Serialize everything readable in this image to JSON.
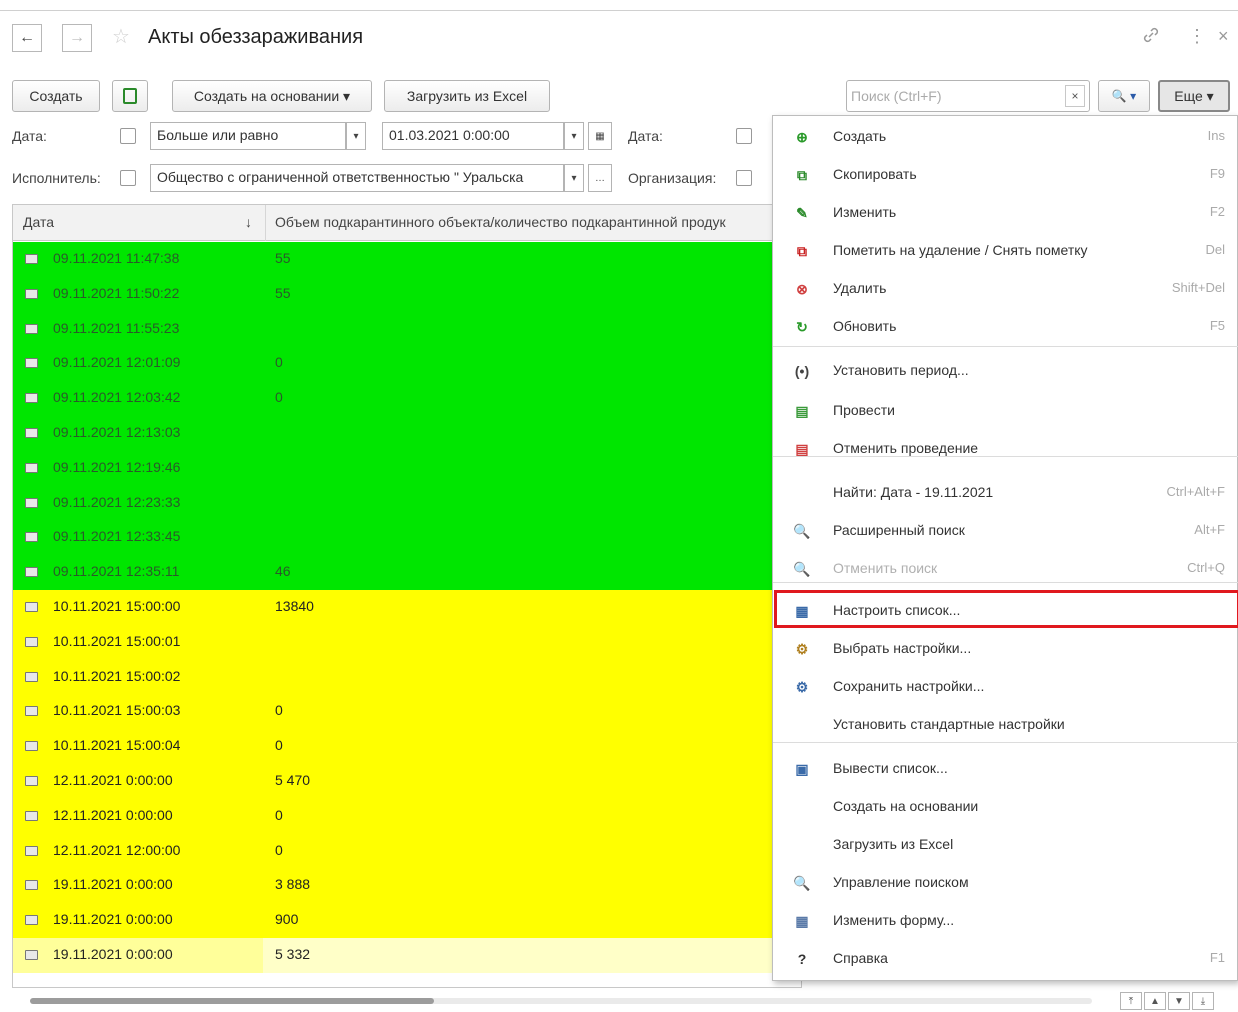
{
  "window": {
    "title": "Акты обеззараживания",
    "back": "←",
    "forward": "→",
    "link_icon": "link-icon",
    "more_icon": "⋮",
    "close": "×"
  },
  "toolbar": {
    "create": "Создать",
    "create_based": "Создать на основании ▾",
    "load_excel": "Загрузить из Excel",
    "search_placeholder": "Поиск (Ctrl+F)",
    "search_clear": "×",
    "search_btn": "🔍 ▾",
    "more": "Еще ▾"
  },
  "filters": {
    "date_label": "Дата:",
    "date_condition": "Больше или равно",
    "date_value": "01.03.2021  0:00:00",
    "date2_label": "Дата:",
    "executor_label": "Исполнитель:",
    "executor_value": "Общество с ограниченной ответственностью \" Уральска",
    "org_label": "Организация:"
  },
  "table": {
    "columns": [
      "Дата",
      "Объем подкарантинного объекта/количество подкарантинной продук"
    ],
    "sort_icon": "↓",
    "rows": [
      {
        "date": "09.11.2021 11:47:38",
        "value": "55",
        "color": "green"
      },
      {
        "date": "09.11.2021 11:50:22",
        "value": "55",
        "color": "green"
      },
      {
        "date": "09.11.2021 11:55:23",
        "value": "",
        "color": "green"
      },
      {
        "date": "09.11.2021 12:01:09",
        "value": "0",
        "color": "green"
      },
      {
        "date": "09.11.2021 12:03:42",
        "value": "0",
        "color": "green"
      },
      {
        "date": "09.11.2021 12:13:03",
        "value": "",
        "color": "green"
      },
      {
        "date": "09.11.2021 12:19:46",
        "value": "",
        "color": "green"
      },
      {
        "date": "09.11.2021 12:23:33",
        "value": "",
        "color": "green"
      },
      {
        "date": "09.11.2021 12:33:45",
        "value": "",
        "color": "green"
      },
      {
        "date": "09.11.2021 12:35:11",
        "value": "46",
        "color": "green"
      },
      {
        "date": "10.11.2021 15:00:00",
        "value": "13840",
        "color": "yellow"
      },
      {
        "date": "10.11.2021 15:00:01",
        "value": "",
        "color": "yellow"
      },
      {
        "date": "10.11.2021 15:00:02",
        "value": "",
        "color": "yellow"
      },
      {
        "date": "10.11.2021 15:00:03",
        "value": "0",
        "color": "yellow"
      },
      {
        "date": "10.11.2021 15:00:04",
        "value": "0",
        "color": "yellow"
      },
      {
        "date": "12.11.2021 0:00:00",
        "value": "5 470",
        "color": "yellow"
      },
      {
        "date": "12.11.2021 0:00:00",
        "value": "0",
        "color": "yellow"
      },
      {
        "date": "12.11.2021 12:00:00",
        "value": "0",
        "color": "yellow"
      },
      {
        "date": "19.11.2021 0:00:00",
        "value": "3 888",
        "color": "yellow"
      },
      {
        "date": "19.11.2021 0:00:00",
        "value": "900",
        "color": "yellow"
      },
      {
        "date": "19.11.2021 0:00:00",
        "value": "5 332",
        "color": "selected"
      }
    ]
  },
  "menu": {
    "items": [
      {
        "label": "Создать",
        "key": "Ins",
        "icon": "plus-circle-icon",
        "glyph": "⊕",
        "color": "#2a9a2a"
      },
      {
        "label": "Скопировать",
        "key": "F9",
        "icon": "copy-icon",
        "glyph": "⧉",
        "color": "#2a8a2a"
      },
      {
        "label": "Изменить",
        "key": "F2",
        "icon": "pencil-icon",
        "glyph": "✎",
        "color": "#2a8a2a"
      },
      {
        "label": "Пометить на удаление / Снять пометку",
        "key": "Del",
        "icon": "mark-delete-icon",
        "glyph": "⧉",
        "color": "#c82020"
      },
      {
        "label": "Удалить",
        "key": "Shift+Del",
        "icon": "delete-icon",
        "glyph": "⊗",
        "color": "#d04040"
      },
      {
        "label": "Обновить",
        "key": "F5",
        "icon": "refresh-icon",
        "glyph": "↻",
        "color": "#2a9a2a"
      },
      {
        "label": "Установить период...",
        "key": "",
        "icon": "period-icon",
        "glyph": "(•)",
        "color": "#444"
      },
      {
        "label": "Провести",
        "key": "",
        "icon": "post-icon",
        "glyph": "▤",
        "color": "#3a9a3a"
      },
      {
        "label": "Отменить проведение",
        "key": "",
        "icon": "unpost-icon",
        "glyph": "▤",
        "color": "#d04040"
      },
      {
        "label": "Найти: Дата - 19.11.2021",
        "key": "Ctrl+Alt+F",
        "icon": "",
        "glyph": "",
        "color": "#444"
      },
      {
        "label": "Расширенный поиск",
        "key": "Alt+F",
        "icon": "advanced-search-icon",
        "glyph": "🔍",
        "color": "#2a5aa8"
      },
      {
        "label": "Отменить поиск",
        "key": "Ctrl+Q",
        "icon": "cancel-search-icon",
        "glyph": "🔍",
        "color": "#d08080"
      },
      {
        "label": "Настроить список...",
        "key": "",
        "icon": "configure-list-icon",
        "glyph": "▦",
        "color": "#3a6aa8"
      },
      {
        "label": "Выбрать настройки...",
        "key": "",
        "icon": "choose-settings-icon",
        "glyph": "⚙",
        "color": "#b08020"
      },
      {
        "label": "Сохранить настройки...",
        "key": "",
        "icon": "save-settings-icon",
        "glyph": "⚙",
        "color": "#3a6aa8"
      },
      {
        "label": "Установить стандартные настройки",
        "key": "",
        "icon": "",
        "glyph": "",
        "color": "#444"
      },
      {
        "label": "Вывести список...",
        "key": "",
        "icon": "print-list-icon",
        "glyph": "▣",
        "color": "#3a6aa8"
      },
      {
        "label": "Создать на основании",
        "key": "",
        "icon": "",
        "glyph": "",
        "color": "#444"
      },
      {
        "label": "Загрузить из Excel",
        "key": "",
        "icon": "",
        "glyph": "",
        "color": "#444"
      },
      {
        "label": "Управление поиском",
        "key": "",
        "icon": "search-settings-icon",
        "glyph": "🔍",
        "color": "#2a5aa8"
      },
      {
        "label": "Изменить форму...",
        "key": "",
        "icon": "change-form-icon",
        "glyph": "▦",
        "color": "#5a7aa8"
      },
      {
        "label": "Справка",
        "key": "F1",
        "icon": "help-icon",
        "glyph": "?",
        "color": "#333"
      }
    ]
  },
  "colors": {
    "green_row": "#00e600",
    "yellow_row": "#ffff00",
    "highlight_border": "#e0181e"
  }
}
